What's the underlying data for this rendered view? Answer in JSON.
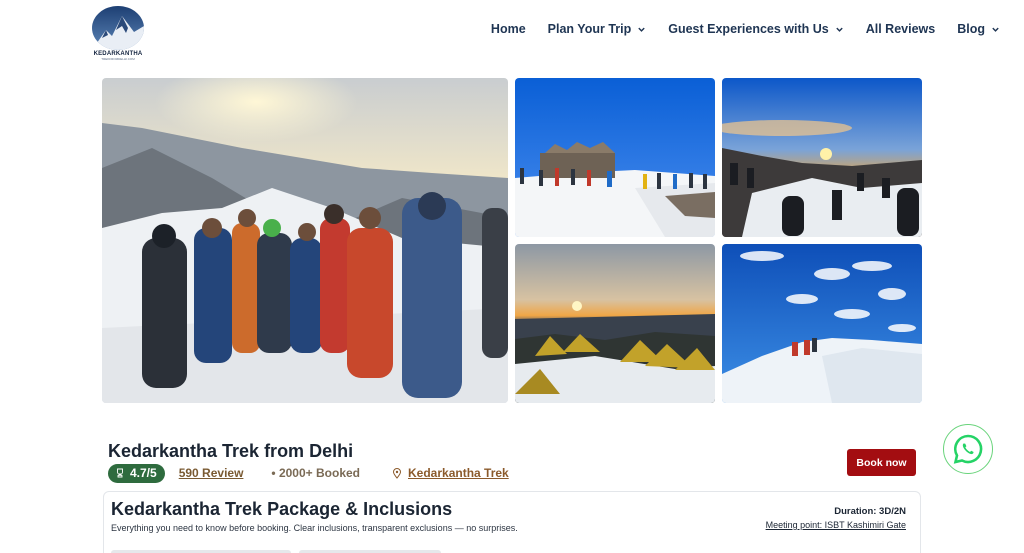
{
  "brand": {
    "name": "KEDARKANTHA",
    "tagline": "TREKFROMDELHI.COM"
  },
  "nav": [
    {
      "label": "Home",
      "dropdown": false
    },
    {
      "label": "Plan Your Trip",
      "dropdown": true
    },
    {
      "label": "Guest Experiences with Us",
      "dropdown": true
    },
    {
      "label": "All Reviews",
      "dropdown": false
    },
    {
      "label": "Blog",
      "dropdown": true
    }
  ],
  "trek": {
    "title": "Kedarkantha Trek from Delhi",
    "rating": "4.7/5",
    "reviews": "590 Review",
    "booked": "• 2000+ Booked",
    "location": "Kedarkantha Trek",
    "book_label": "Book now"
  },
  "package": {
    "title": "Kedarkantha Trek Package & Inclusions",
    "subtitle": "Everything you need to know before booking. Clear inclusions, transparent exclusions — no surprises.",
    "duration": "Duration: 3D/2N",
    "meeting": "Meeting point: ISBT Kashimiri Gate"
  },
  "colors": {
    "accent": "#a30d11",
    "rating_bg": "#2e6b3e",
    "whatsapp": "#25d366"
  },
  "icons": {
    "chevron": "chevron-down-icon",
    "rating": "trophy-icon",
    "location": "map-pin-icon",
    "whatsapp": "whatsapp-icon"
  }
}
